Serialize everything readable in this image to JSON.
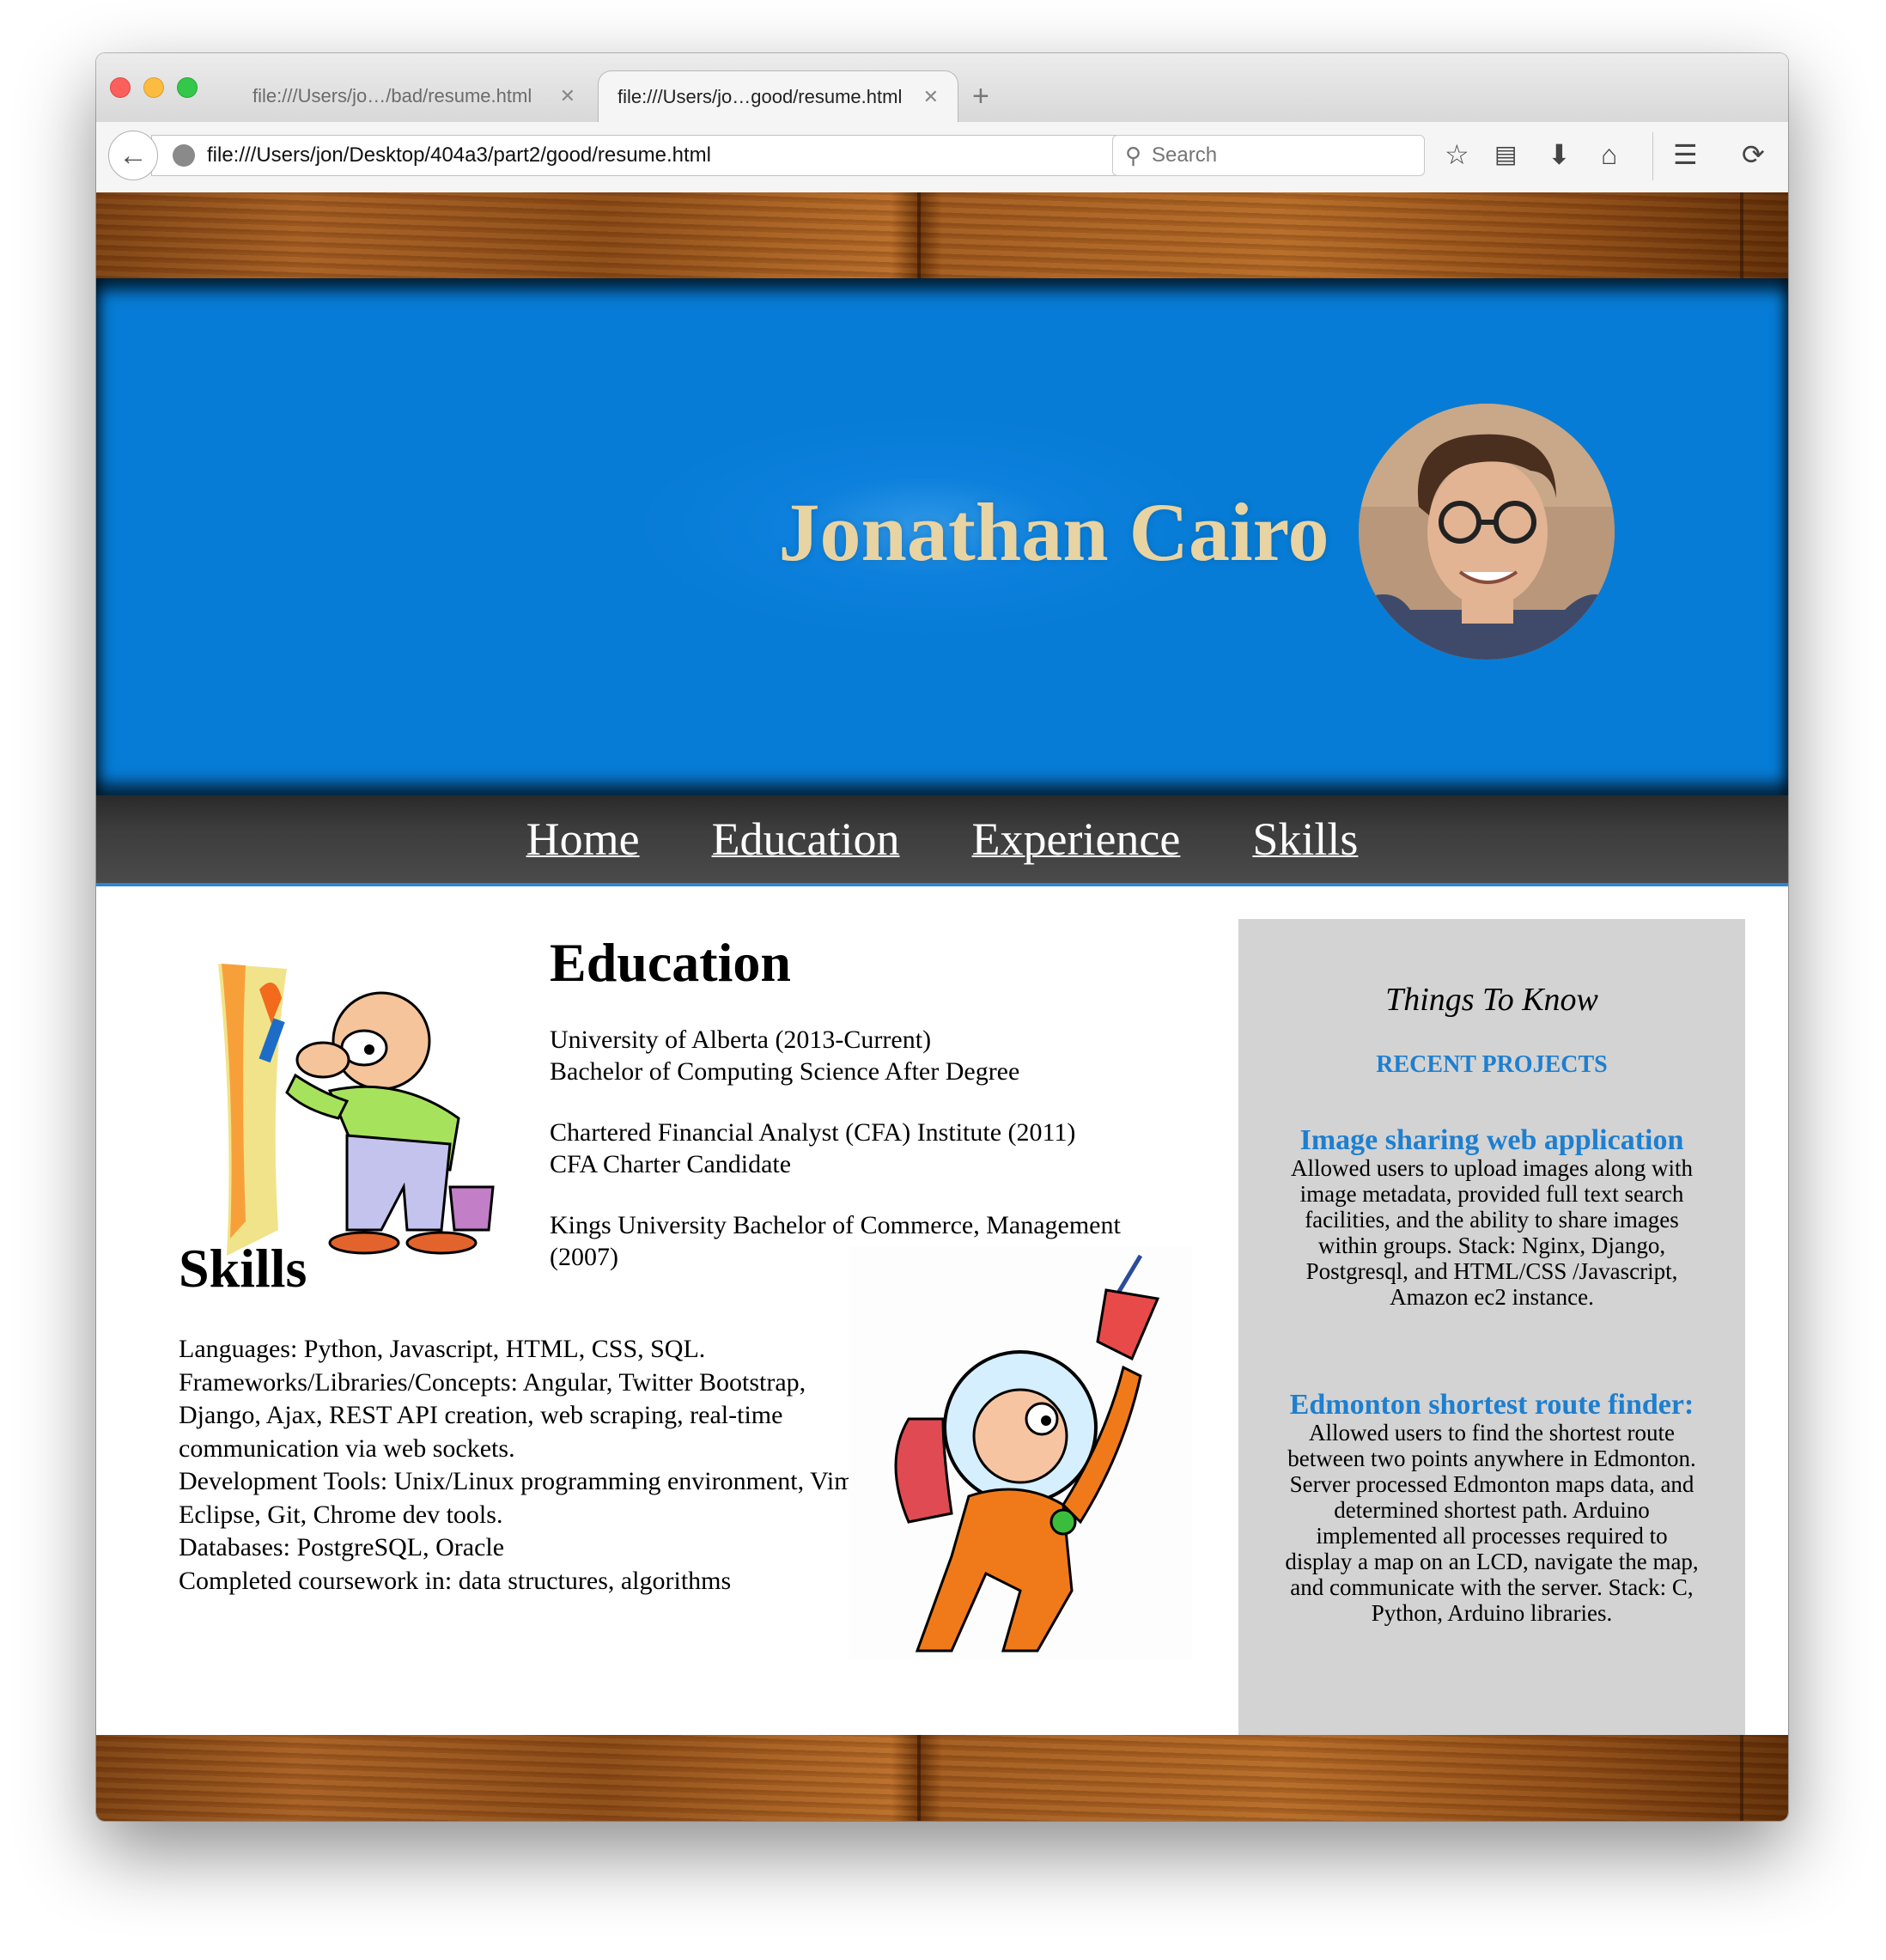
{
  "browser": {
    "tabs": [
      {
        "label": "file:///Users/jo…/bad/resume.html",
        "close": "✕"
      },
      {
        "label": "file:///Users/jo…good/resume.html",
        "close": "✕"
      }
    ],
    "new_tab": "+",
    "url": "file:///Users/jon/Desktop/404a3/part2/good/resume.html",
    "search_placeholder": "Search",
    "icons": [
      "back-arrow-icon",
      "globe-icon",
      "dropdown-icon",
      "reload-icon",
      "search-icon",
      "star-icon",
      "reading-list-icon",
      "download-icon",
      "home-icon",
      "menu-icon",
      "sync-icon"
    ]
  },
  "header": {
    "name": "Jonathan Cairo"
  },
  "nav": {
    "items": [
      "Home",
      "Education",
      "Experience",
      "Skills"
    ]
  },
  "education": {
    "heading": "Education",
    "entries": [
      {
        "line1": "University of Alberta (2013-Current)",
        "line2": "Bachelor of Computing Science After Degree"
      },
      {
        "line1": "Chartered Financial Analyst (CFA) Institute (2011)",
        "line2": "CFA Charter Candidate"
      },
      {
        "line1": "Kings University Bachelor of Commerce, Management (2007)",
        "line2": ""
      }
    ]
  },
  "skills": {
    "heading": "Skills",
    "lines": [
      "Languages: Python, Javascript, HTML, CSS, SQL.",
      "Frameworks/Libraries/Concepts: Angular, Twitter Bootstrap, Django, Ajax, REST API creation, web scraping, real-time communication via web sockets.",
      "Development Tools: Unix/Linux programming environment, Vim, Eclipse, Git, Chrome dev tools.",
      "Databases: PostgreSQL, Oracle",
      "Completed coursework in: data structures, algorithms"
    ]
  },
  "sidebar": {
    "title": "Things To Know",
    "subtitle": "RECENT PROJECTS",
    "projects": [
      {
        "title": "Image sharing web application",
        "desc": "Allowed users to upload images along with image metadata, provided full text search facilities, and the ability to share images within groups. Stack: Nginx, Django, Postgresql, and HTML/CSS /Javascript, Amazon ec2 instance."
      },
      {
        "title": "Edmonton shortest route finder:",
        "desc": "Allowed users to find the shortest route between two points anywhere in Edmonton. Server processed Edmonton maps data, and determined shortest path. Arduino implemented all processes required to display a map on an LCD, navigate the map, and communicate with the server. Stack: C, Python, Arduino libraries."
      }
    ]
  },
  "colors": {
    "hero_blue": "#077cd6",
    "name_gold": "#e8d3a2",
    "link_blue": "#1d7fd0",
    "sidebar_gray": "#d3d3d3"
  }
}
